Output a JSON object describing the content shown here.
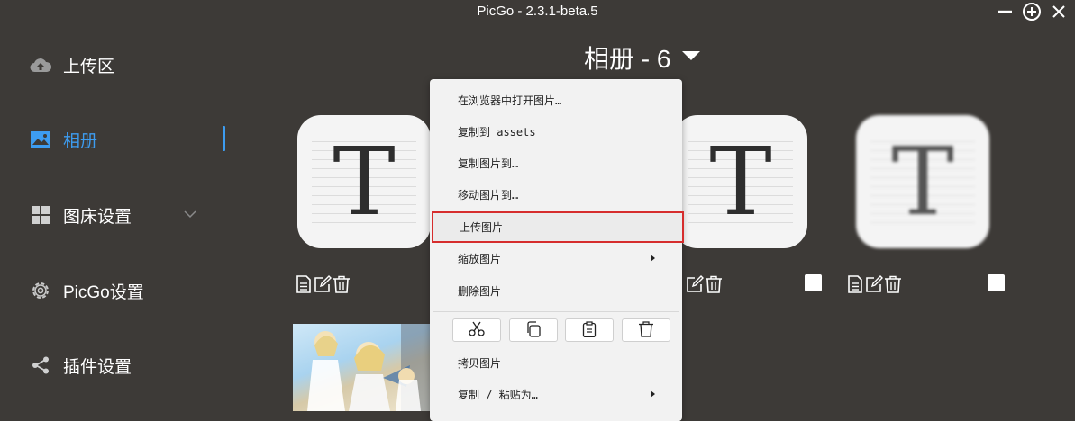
{
  "window": {
    "title": "PicGo - 2.3.1-beta.5",
    "controls": [
      "minimize-icon",
      "maximize-icon",
      "close-icon"
    ]
  },
  "sidebar": {
    "items": [
      {
        "label": "上传区",
        "icon": "cloud-upload-icon",
        "active": false
      },
      {
        "label": "相册",
        "icon": "image-icon",
        "active": true
      },
      {
        "label": "图床设置",
        "icon": "grid-icon",
        "active": false,
        "expandable": true
      },
      {
        "label": "PicGo设置",
        "icon": "gear-icon",
        "active": false
      },
      {
        "label": "插件设置",
        "icon": "share-icon",
        "active": false
      }
    ],
    "accent_color": "#3d9cf0"
  },
  "gallery": {
    "header": "相册 - 6",
    "thumbnails": [
      {
        "glyph": "T",
        "style": "sharp"
      },
      {
        "glyph": "T",
        "style": "sharp"
      },
      {
        "glyph": "T",
        "style": "blurred"
      }
    ],
    "item_actions": [
      "file-icon",
      "edit-icon",
      "trash-icon"
    ]
  },
  "context_menu": {
    "items": [
      {
        "label": "在浏览器中打开图片…",
        "submenu": false
      },
      {
        "label": "复制到 assets",
        "submenu": false
      },
      {
        "label": "复制图片到…",
        "submenu": false
      },
      {
        "label": "移动图片到…",
        "submenu": false
      },
      {
        "label": "上传图片",
        "submenu": false,
        "highlighted": true
      },
      {
        "label": "缩放图片",
        "submenu": true
      },
      {
        "label": "删除图片",
        "submenu": false
      }
    ],
    "clipboard_buttons": [
      "scissors-icon",
      "copy-icon",
      "clipboard-icon",
      "trash-icon"
    ],
    "bottom_items": [
      {
        "label": "拷贝图片",
        "submenu": false
      },
      {
        "label": "复制 / 粘贴为…",
        "submenu": true
      }
    ],
    "highlight_color": "#d62d2d"
  }
}
